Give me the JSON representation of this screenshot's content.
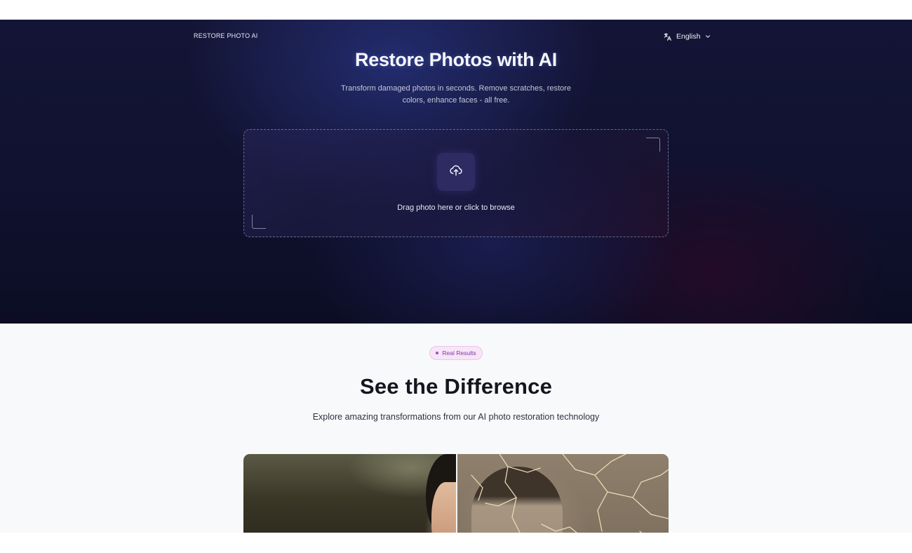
{
  "header": {
    "brand": "RESTORE PHOTO AI",
    "language": "English",
    "language_icon": "translate-icon",
    "dropdown_icon": "chevron-down-icon"
  },
  "hero": {
    "title": "Restore Photos with AI",
    "subtitle": "Transform damaged photos in seconds. Remove scratches, restore colors, enhance faces - all free."
  },
  "upload": {
    "icon": "cloud-upload-icon",
    "prompt": "Drag photo here or click to browse"
  },
  "results": {
    "badge": "Real Results",
    "title": "See the Difference",
    "subtitle": "Explore amazing transformations from our AI photo restoration technology"
  },
  "colors": {
    "hero_background": "#121433",
    "badge_background": "#f8e5f7",
    "badge_text": "#7a3aa0",
    "section_background": "#f8f9fb"
  }
}
